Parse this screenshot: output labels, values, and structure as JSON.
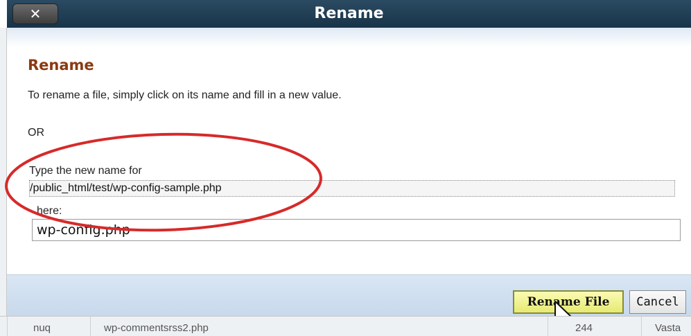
{
  "dialog": {
    "title": "Rename",
    "close_icon": "close-icon",
    "close_label": "✕"
  },
  "content": {
    "heading": "Rename",
    "description": "To rename a file, simply click on its name and fill in a new value.",
    "or_text": "OR",
    "prompt_label": "Type the new name for",
    "current_path": "/public_html/test/wp-config-sample.php",
    "here_label": "here:",
    "new_name_value": "wp-config.php"
  },
  "footer": {
    "rename_button": "Rename File",
    "cancel_button": "Cancel"
  },
  "background_row": {
    "cells": [
      "nuq",
      "wp-commentsrss2.php",
      "244",
      "Vasta"
    ]
  },
  "colors": {
    "titlebar": "#1f3d55",
    "heading": "#8b3a12",
    "highlight_ellipse": "#d62a2a",
    "rename_button_bg": "#eef19a"
  }
}
